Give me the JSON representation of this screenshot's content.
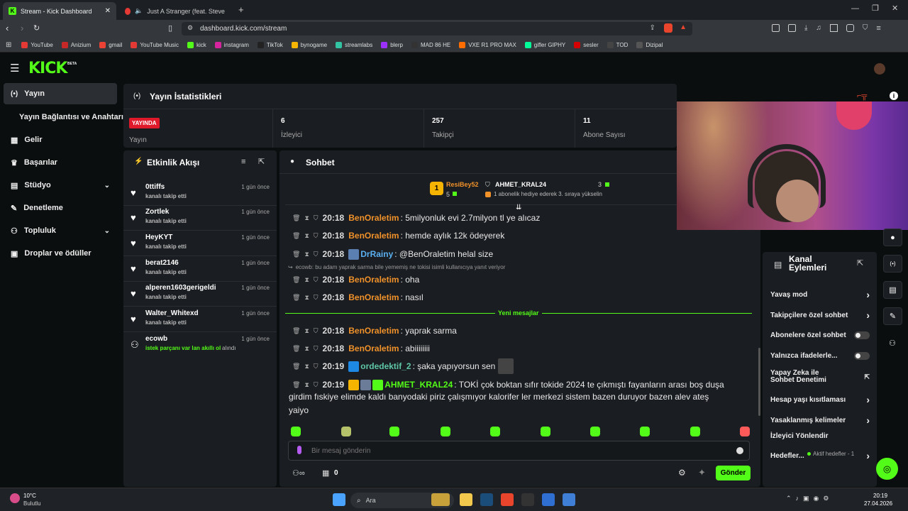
{
  "browser": {
    "tabs": [
      {
        "title": "Stream - Kick Dashboard",
        "active": true
      },
      {
        "title": "Just A Stranger (feat. Steve Lacy) |",
        "active": false
      }
    ],
    "url": "dashboard.kick.com/stream",
    "bookmarks": [
      {
        "label": "YouTube",
        "color": "#e53935"
      },
      {
        "label": "Anizium",
        "color": "#c62828"
      },
      {
        "label": "gmail",
        "color": "#ea4335"
      },
      {
        "label": "YouTube Music",
        "color": "#e53935"
      },
      {
        "label": "kick",
        "color": "#53fc18"
      },
      {
        "label": "instagram",
        "color": "#d6249f"
      },
      {
        "label": "TikTok",
        "color": "#222222"
      },
      {
        "label": "bynogame",
        "color": "#f4b400"
      },
      {
        "label": "streamlabs",
        "color": "#31c3a2"
      },
      {
        "label": "blerp",
        "color": "#9b30ff"
      },
      {
        "label": "MAD 86 HE",
        "color": "#333333"
      },
      {
        "label": "VXE R1 PRO MAX",
        "color": "#ff6d00"
      },
      {
        "label": "gifler GIPHY",
        "color": "#00ff99"
      },
      {
        "label": "sesler",
        "color": "#d50000"
      },
      {
        "label": "TOD",
        "color": "#444444"
      },
      {
        "label": "Dizipal",
        "color": "#555555"
      }
    ]
  },
  "app": {
    "logo": "KICK",
    "logo_badge": "BETA",
    "brand_color": "#53fc18"
  },
  "sidebar": {
    "items": [
      {
        "label": "Yayın",
        "icon": "broadcast-icon"
      },
      {
        "label": "Yayın Bağlantısı ve Anahtarı",
        "icon": ""
      },
      {
        "label": "Gelir",
        "icon": "chart-icon"
      },
      {
        "label": "Başarılar",
        "icon": "trophy-icon"
      },
      {
        "label": "Stüdyo",
        "icon": "grid-icon"
      },
      {
        "label": "Denetleme",
        "icon": "wrench-icon"
      },
      {
        "label": "Topluluk",
        "icon": "users-icon"
      },
      {
        "label": "Droplar ve ödüller",
        "icon": "gift-icon"
      }
    ]
  },
  "stats": {
    "title": "Yayın İstatistikleri",
    "live_badge": "YAYINDA",
    "cells": [
      {
        "value": "",
        "label": "Yayın"
      },
      {
        "value": "6",
        "label": "İzleyici"
      },
      {
        "value": "257",
        "label": "Takipçi"
      },
      {
        "value": "11",
        "label": "Abone Sayısı"
      }
    ]
  },
  "activity": {
    "title": "Etkinlik Akışı",
    "events": [
      {
        "name": "0ttiffs",
        "sub": "kanalı takip etti",
        "time": "1 gün önce"
      },
      {
        "name": "Zortlek",
        "sub": "kanalı takip etti",
        "time": "1 gün önce"
      },
      {
        "name": "HeyKYT",
        "sub": "kanalı takip etti",
        "time": "1 gün önce"
      },
      {
        "name": "berat2146",
        "sub": "kanalı takip etti",
        "time": "1 gün önce"
      },
      {
        "name": "alperen1603gerigeldi",
        "sub": "kanalı takip etti",
        "time": "1 gün önce"
      },
      {
        "name": "Walter_Whitexd",
        "sub": "kanalı takip etti",
        "time": "1 gün önce"
      },
      {
        "name": "ecowb",
        "sub": "istek parçanı var lan akıllı ol",
        "sub2": "alındı",
        "time": "1 gün önce"
      }
    ]
  },
  "chat": {
    "title": "Sohbet",
    "leaderboard": {
      "first_user": "ResiBey52",
      "first_count": "5",
      "second_user": "AHMET_KRAL24",
      "second_count": "3",
      "second_note": "1 abonelik hediye ederek 3. sıraya yükselin"
    },
    "messages": [
      {
        "time": "20:18",
        "user": "BenOraletim",
        "text": ": 5milyonluk evi 2.7milyon tl ye alıcaz"
      },
      {
        "time": "20:18",
        "user": "BenOraletim",
        "text": ": hemde aylık 12k ödeyerek"
      },
      {
        "time": "20:18",
        "user": "DrRainy",
        "text": ": @BenOraletim helal size"
      },
      {
        "reply": "ecowb: bu adam yaprak sarma bile yememiş ne tokisi isimli kullanıcıya yanıt veriyor"
      },
      {
        "time": "20:18",
        "user": "BenOraletim",
        "text": ": oha"
      },
      {
        "time": "20:18",
        "user": "BenOraletim",
        "text": ": nasıl"
      },
      {
        "time": "20:18",
        "user": "BenOraletim",
        "text": ": yaprak sarma"
      },
      {
        "time": "20:18",
        "user": "BenOraletim",
        "text": ": abiiiiiiii"
      },
      {
        "time": "20:19",
        "user": "ordedektif_2",
        "text": ": şaka yapıyorsun sen"
      },
      {
        "time": "20:19",
        "user": "AHMET_KRAL24",
        "text": ": TOKİ çok boktan sıfır tokide 2024 te çıkmıştı fayanların arası boş duşa",
        "text2": "girdim fıskiye elimde kaldı banyodaki piriz çalışmıyor kalorifer ler merkezi sistem bazen duruyor bazen alev ateş",
        "text3": "yaiyo"
      }
    ],
    "new_messages_label": "Yeni mesajlar",
    "input_placeholder": "Bir mesaj gönderin",
    "send_label": "Gönder",
    "footer_count": "0"
  },
  "channel_actions": {
    "title": "Kanal Eylemleri",
    "items": [
      {
        "label": "Yavaş mod",
        "kind": "chevron"
      },
      {
        "label": "Takipçilere özel sohbet",
        "kind": "chevron"
      },
      {
        "label": "Abonelere özel sohbet",
        "kind": "toggle"
      },
      {
        "label": "Yalnızca ifadelerle...",
        "kind": "toggle"
      },
      {
        "label": "Yapay Zeka ile Sohbet Denetimi",
        "kind": "external"
      },
      {
        "label": "Hesap yaşı kısıtlaması",
        "kind": "chevron"
      },
      {
        "label": "Yasaklanmış kelimeler",
        "kind": "chevron"
      },
      {
        "label": "İzleyici Yönlendir",
        "kind": "none"
      },
      {
        "label": "Hedefler...",
        "kind": "chevron",
        "note": "Aktif hedefler - 1"
      }
    ]
  },
  "taskbar": {
    "weather_temp": "10°C",
    "weather_desc": "Bulutlu",
    "search_label": "Ara",
    "clock_time": "20:19",
    "clock_date": "27.04.2026"
  }
}
